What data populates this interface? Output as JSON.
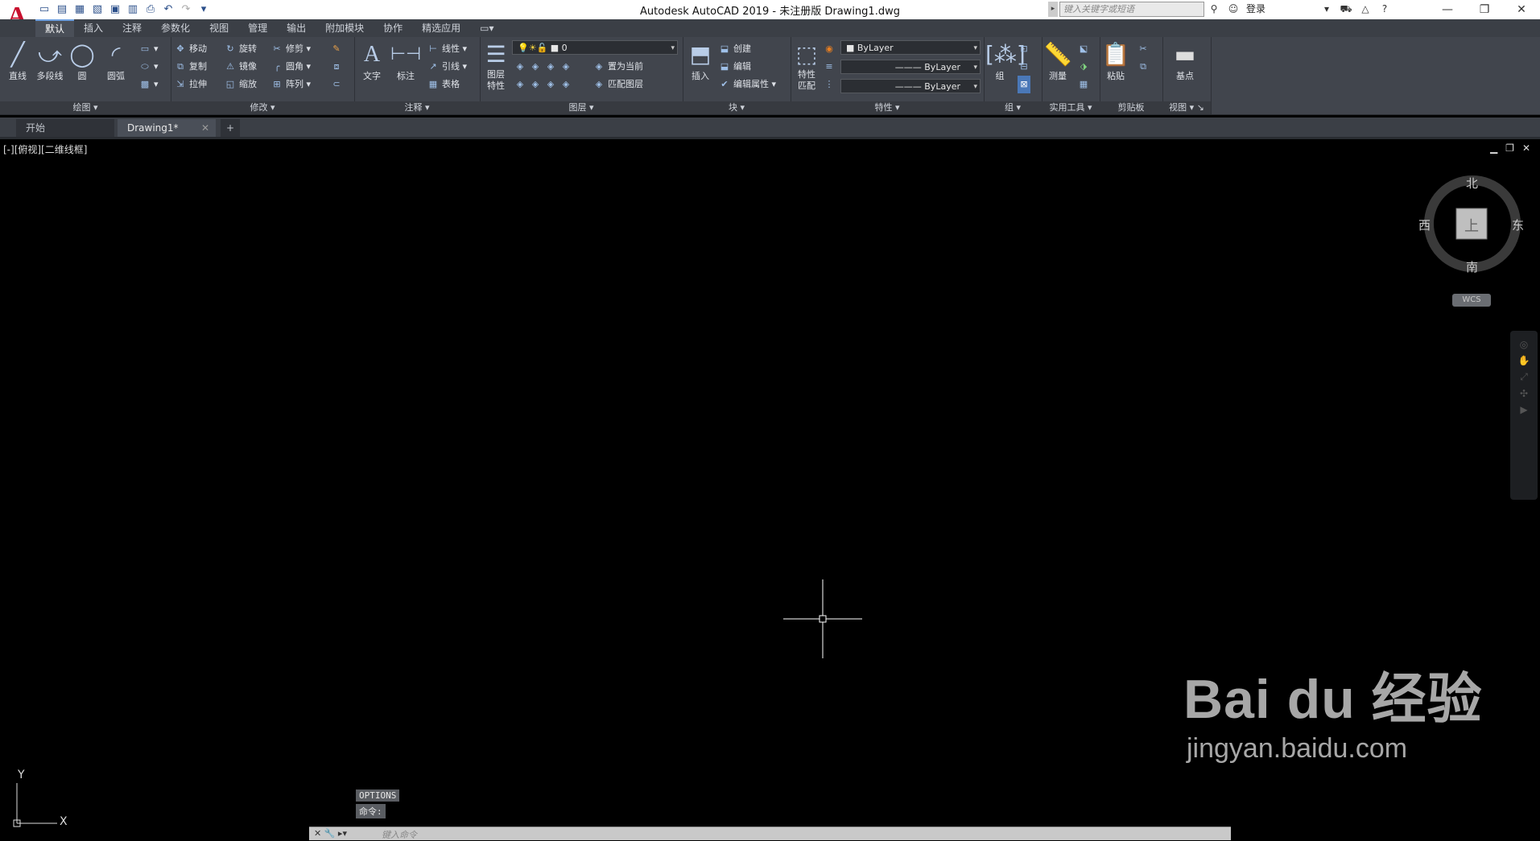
{
  "titlebar": {
    "app_logo": "A",
    "title": "Autodesk AutoCAD 2019 - 未注册版    Drawing1.dwg",
    "search_placeholder": "键入关键字或短语",
    "login_label": "登录",
    "qat_icons": [
      "new-icon",
      "open-icon",
      "save-icon",
      "saveas-icon",
      "web-icon",
      "plot-icon",
      "print-icon",
      "undo-icon",
      "redo-icon",
      "customize-icon"
    ]
  },
  "menubar": {
    "tabs": [
      "默认",
      "插入",
      "注释",
      "参数化",
      "视图",
      "管理",
      "输出",
      "附加模块",
      "协作",
      "精选应用"
    ]
  },
  "ribbon": {
    "draw": {
      "title": "绘图",
      "line": "直线",
      "polyline": "多段线",
      "circle": "圆",
      "arc": "圆弧"
    },
    "modify": {
      "title": "修改",
      "move": "移动",
      "rotate": "旋转",
      "trim": "修剪",
      "copy": "复制",
      "mirror": "镜像",
      "fillet": "圆角",
      "stretch": "拉伸",
      "scale": "缩放",
      "array": "阵列"
    },
    "annotation": {
      "title": "注释",
      "text": "文字",
      "dimension": "标注",
      "linear": "线性",
      "leader": "引线",
      "table": "表格"
    },
    "layers": {
      "title": "图层",
      "layer_props": "图层特性",
      "layer_combo": "0",
      "set_current": "置为当前",
      "match_layer": "匹配图层"
    },
    "block": {
      "title": "块",
      "insert": "插入",
      "create": "创建",
      "edit": "编辑",
      "edit_attr": "编辑属性"
    },
    "properties": {
      "title": "特性",
      "match_props": "特性匹配",
      "color": "ByLayer",
      "linetype": "ByLayer",
      "lineweight": "ByLayer"
    },
    "groups": {
      "title": "组",
      "group": "组"
    },
    "utilities": {
      "title": "实用工具",
      "measure": "测量"
    },
    "clipboard": {
      "title": "剪贴板",
      "paste": "粘贴"
    },
    "view": {
      "title": "视图",
      "base": "基点"
    }
  },
  "doctabs": {
    "start": "开始",
    "drawing": "Drawing1*",
    "add": "+"
  },
  "canvas": {
    "view_label": "[-][俯视][二维线框]",
    "viewcube": {
      "north": "北",
      "south": "南",
      "east": "东",
      "west": "西",
      "face": "上"
    },
    "wcs": "WCS",
    "ucs_x": "X",
    "ucs_y": "Y",
    "cmd_history": [
      "OPTIONS",
      "命令:"
    ],
    "cmd_placeholder": "键入命令"
  },
  "watermark": {
    "brand": "Bai  du 经验",
    "url": "jingyan.baidu.com"
  }
}
